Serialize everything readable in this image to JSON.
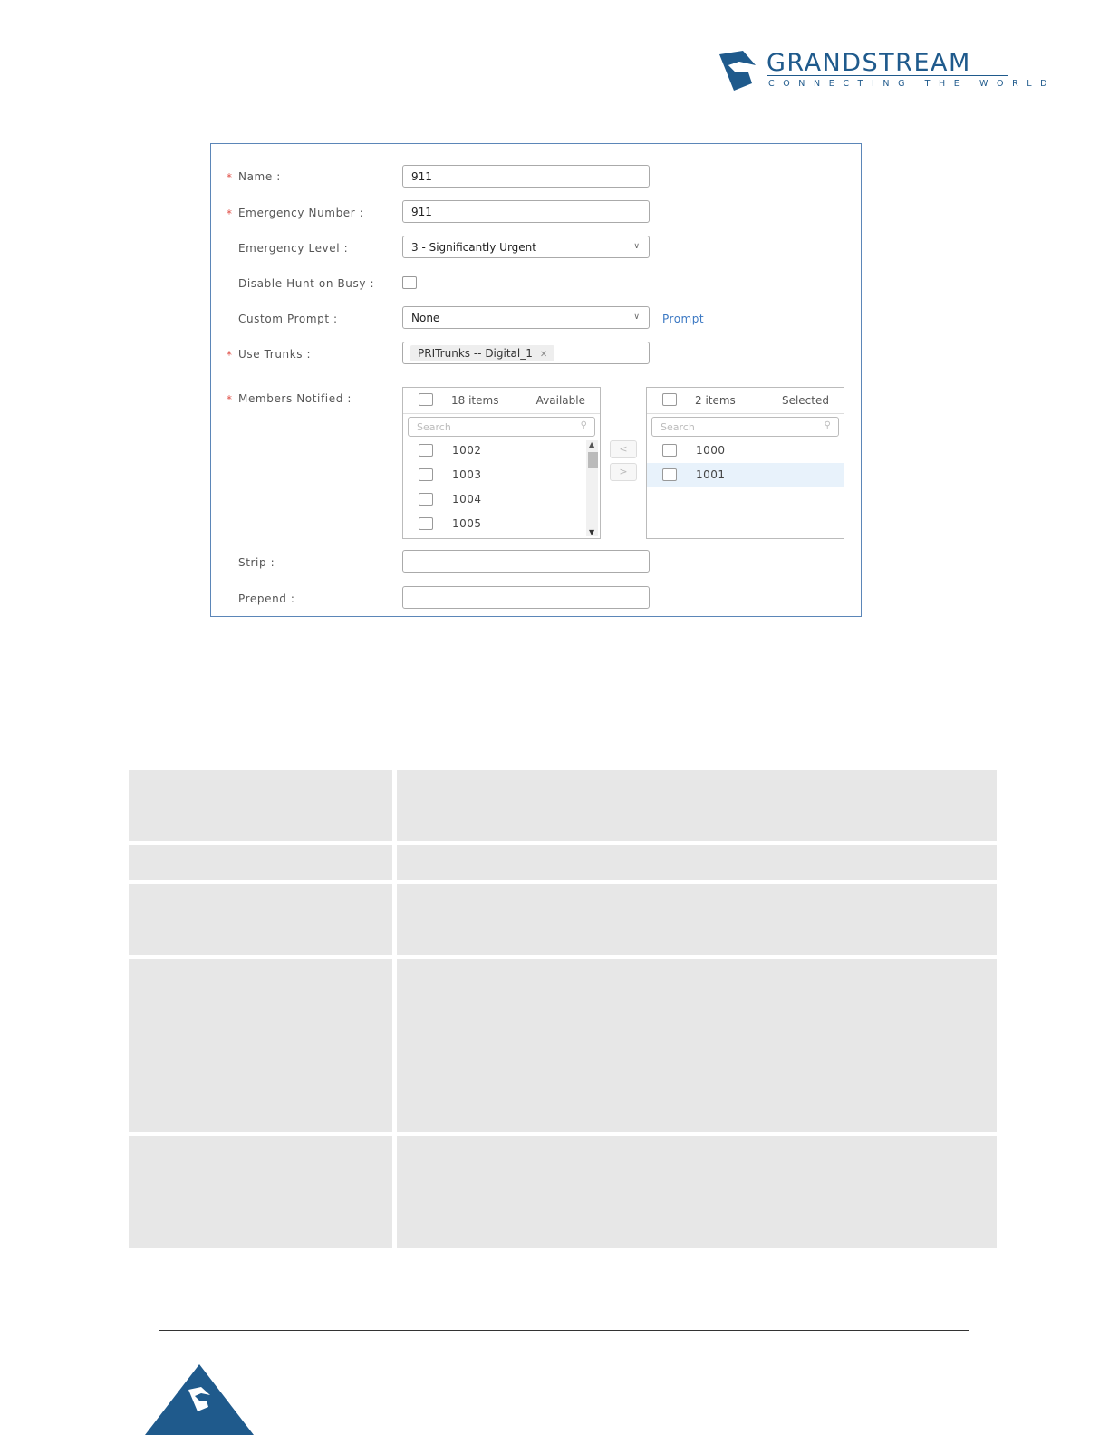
{
  "brand": {
    "name": "GRANDSTREAM",
    "tagline": "CONNECTING THE WORLD",
    "colors": {
      "primary": "#1f5a8c",
      "accent": "#5b86b8"
    }
  },
  "form": {
    "name": {
      "label": "Name :",
      "value": "911",
      "required": true
    },
    "emergency_number": {
      "label": "Emergency Number :",
      "value": "911",
      "required": true
    },
    "emergency_level": {
      "label": "Emergency Level :",
      "value": "3 - Significantly Urgent"
    },
    "disable_hunt": {
      "label": "Disable Hunt on Busy :",
      "checked": false
    },
    "custom_prompt": {
      "label": "Custom Prompt :",
      "value": "None",
      "link": "Prompt"
    },
    "use_trunks": {
      "label": "Use Trunks :",
      "tag": "PRITrunks -- Digital_1",
      "required": true
    },
    "members_notified": {
      "label": "Members Notified :",
      "available": {
        "count": "18 items",
        "state": "Available",
        "search_placeholder": "Search",
        "items": [
          "1002",
          "1003",
          "1004",
          "1005"
        ]
      },
      "selected": {
        "count": "2 items",
        "state": "Selected",
        "search_placeholder": "Search",
        "items": [
          "1000",
          "1001"
        ]
      },
      "move_left": "<",
      "move_right": ">"
    },
    "strip": {
      "label": "Strip :",
      "value": ""
    },
    "prepend": {
      "label": "Prepend :",
      "value": ""
    },
    "required_marker": "*"
  },
  "icons": {
    "select_caret": "chevron-down-icon",
    "search": "search-icon",
    "tag_remove": "close-icon"
  }
}
